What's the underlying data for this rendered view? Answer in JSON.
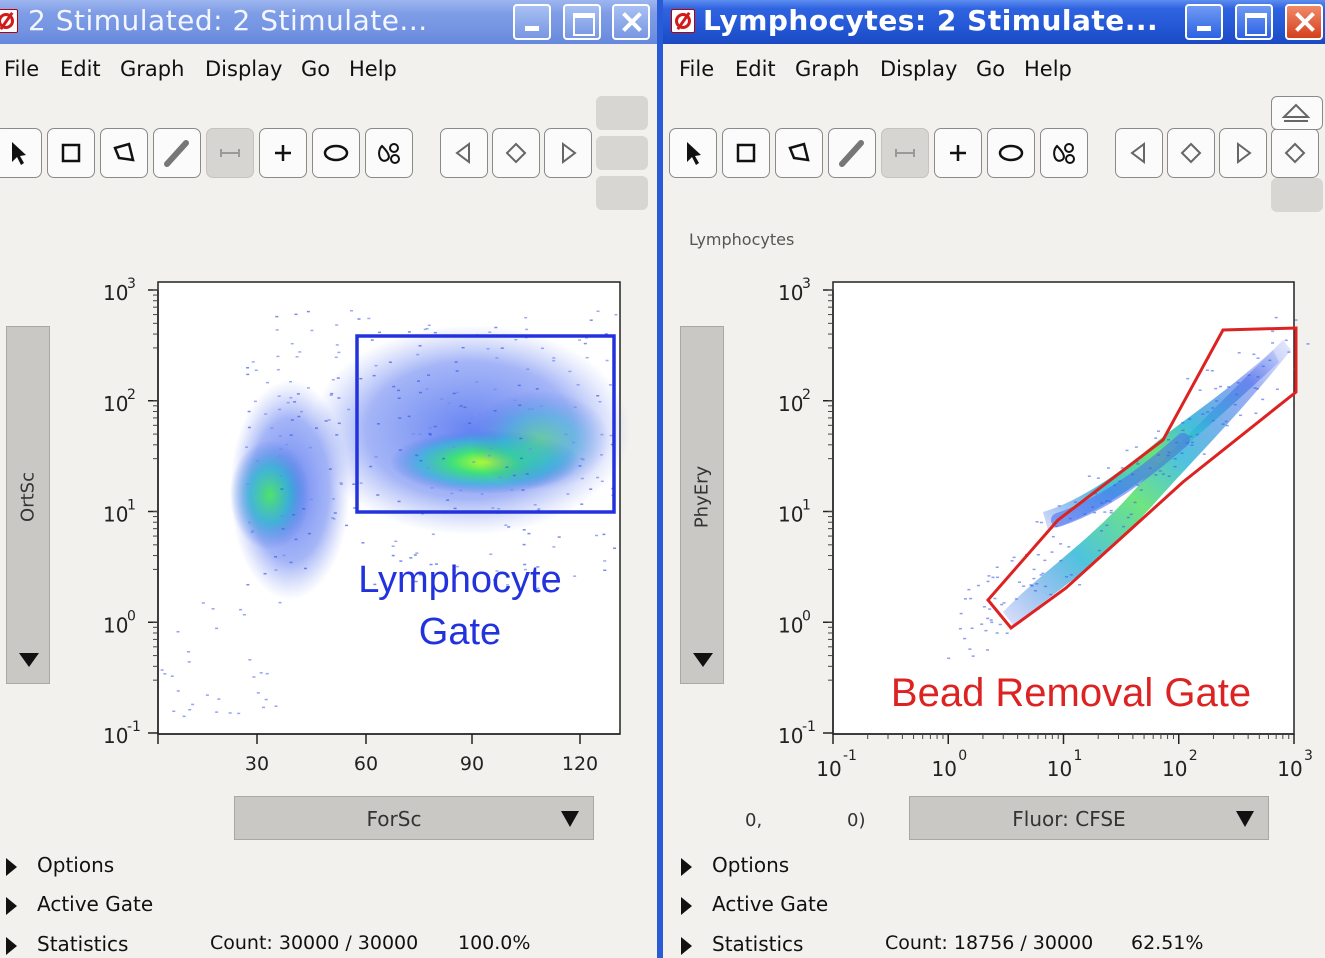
{
  "left_window": {
    "title": "2 Stimulated: 2 Stimulate...",
    "menu": [
      "File",
      "Edit",
      "Graph",
      "Display",
      "Go",
      "Help"
    ],
    "y_axis_param": "OrtSc",
    "x_axis_param": "ForSc",
    "plot": {
      "y_ticks": [
        "10",
        "10",
        "10",
        "10",
        "10"
      ],
      "y_exponents": [
        "3",
        "2",
        "1",
        "0",
        "-1"
      ],
      "x_ticks": [
        "30",
        "60",
        "90",
        "120"
      ],
      "gate_label_line1": "Lymphocyte",
      "gate_label_line2": "Gate",
      "gate_color": "#2233dd"
    },
    "options_label": "Options",
    "active_gate_label": "Active Gate",
    "statistics_label": "Statistics",
    "count": "Count: 30000 / 30000",
    "percent": "100.0%"
  },
  "right_window": {
    "title": "Lymphocytes: 2 Stimulate...",
    "menu": [
      "File",
      "Edit",
      "Graph",
      "Display",
      "Go",
      "Help"
    ],
    "plot_title": "Lymphocytes",
    "y_axis_param": "PhyEry",
    "x_axis_param": "Fluor: CFSE",
    "coord_x": "0,",
    "coord_y": "0)",
    "plot": {
      "y_ticks": [
        "10",
        "10",
        "10",
        "10",
        "10"
      ],
      "y_exponents": [
        "3",
        "2",
        "1",
        "0",
        "-1"
      ],
      "x_ticks": [
        "10",
        "10",
        "10",
        "10",
        "10"
      ],
      "x_exponents": [
        "-1",
        "0",
        "1",
        "2",
        "3"
      ],
      "gate_label": "Bead Removal Gate",
      "gate_color": "#dd2222"
    },
    "options_label": "Options",
    "active_gate_label": "Active Gate",
    "statistics_label": "Statistics",
    "count": "Count: 18756 / 30000",
    "percent": "62.51%"
  },
  "icons": {
    "tools": [
      "arrow-pointer-icon",
      "rectangle-gate-icon",
      "polygon-gate-icon",
      "freehand-gate-icon",
      "range-gate-icon",
      "quadrant-gate-icon",
      "ellipse-gate-icon",
      "auto-gate-icon"
    ],
    "nav": [
      "previous-icon",
      "diamond-icon",
      "next-icon"
    ]
  }
}
